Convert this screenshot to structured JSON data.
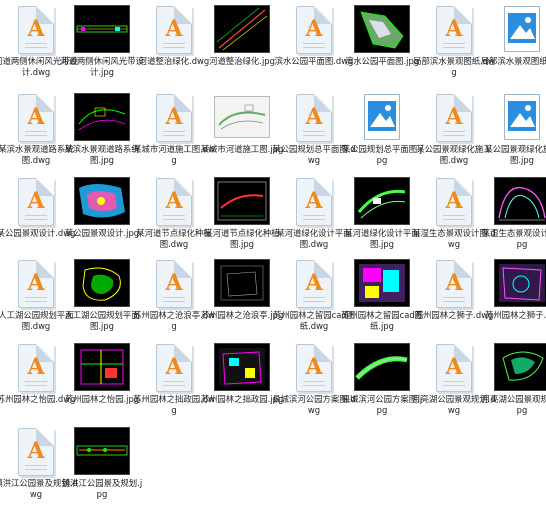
{
  "files": [
    {
      "label": "河道两侧休闲风光带设计.dwg",
      "kind": "dwg"
    },
    {
      "label": "河道两侧休闲风光带设计.jpg",
      "kind": "cad-strip"
    },
    {
      "label": "河道整治绿化.dwg",
      "kind": "dwg"
    },
    {
      "label": "河道整治绿化.jpg",
      "kind": "cad-diag"
    },
    {
      "label": "滨水公园平面图.dwg",
      "kind": "dwg"
    },
    {
      "label": "滨水公园平面图.jpg",
      "kind": "cad-park"
    },
    {
      "label": "局部滨水景观图纸.dwg",
      "kind": "dwg"
    },
    {
      "label": "局部滨水景观图纸.jpg",
      "kind": "image"
    },
    {
      "label": "某滨水景观道路系统图.dwg",
      "kind": "dwg"
    },
    {
      "label": "某滨水景观道路系统图.jpg",
      "kind": "cad-road"
    },
    {
      "label": "某城市河道施工图.dwg",
      "kind": "dwg"
    },
    {
      "label": "某城市河道施工图.jpg",
      "kind": "sketch"
    },
    {
      "label": "某公园规划总平面图.dwg",
      "kind": "dwg"
    },
    {
      "label": "某公园规划总平面图.jpg",
      "kind": "image"
    },
    {
      "label": "某公园景观绿化施工图.dwg",
      "kind": "dwg"
    },
    {
      "label": "某公园景观绿化施工图.jpg",
      "kind": "image"
    },
    {
      "label": "某公园景观设计.dwg",
      "kind": "dwg"
    },
    {
      "label": "某公园景观设计.jpg",
      "kind": "cad-color"
    },
    {
      "label": "某河道节点绿化种植图.dwg",
      "kind": "dwg"
    },
    {
      "label": "某河道节点绿化种植图.jpg",
      "kind": "cad-frame"
    },
    {
      "label": "某河道绿化设计平面图.dwg",
      "kind": "dwg"
    },
    {
      "label": "某河道绿化设计平面图.jpg",
      "kind": "cad-green"
    },
    {
      "label": "某湿生态景观设计图.dwg",
      "kind": "dwg"
    },
    {
      "label": "某湿生态景观设计图.jpg",
      "kind": "cad-curve"
    },
    {
      "label": "人工湖公园规划平面图.dwg",
      "kind": "dwg"
    },
    {
      "label": "人工湖公园规划平面图.jpg",
      "kind": "cad-lake"
    },
    {
      "label": "苏州园林之沧浪亭.dwg",
      "kind": "dwg"
    },
    {
      "label": "苏州园林之沧浪亭.jpg",
      "kind": "cad-dark"
    },
    {
      "label": "苏州园林之留园cad图纸.dwg",
      "kind": "dwg"
    },
    {
      "label": "苏州园林之留园cad图纸.jpg",
      "kind": "cad-purple"
    },
    {
      "label": "苏州园林之狮子.dwg",
      "kind": "dwg"
    },
    {
      "label": "苏州园林之狮子.jpg",
      "kind": "cad-purple2"
    },
    {
      "label": "苏州园林之怡园.dwg",
      "kind": "dwg"
    },
    {
      "label": "苏州园林之怡园.jpg",
      "kind": "cad-multi"
    },
    {
      "label": "苏州园林之拙政园.dwg",
      "kind": "dwg"
    },
    {
      "label": "苏州园林之拙政园.jpg",
      "kind": "cad-multi2"
    },
    {
      "label": "县城滨河公园方案图.dwg",
      "kind": "dwg"
    },
    {
      "label": "县城滨河公园方案图.jpg",
      "kind": "cad-band"
    },
    {
      "label": "月亮湖公园景观规划.dwg",
      "kind": "dwg"
    },
    {
      "label": "月亮湖公园景观规划.jpg",
      "kind": "cad-moon"
    },
    {
      "label": "镇洪江公园景及规划.dwg",
      "kind": "dwg"
    },
    {
      "label": "镇洪江公园景及规划.jpg",
      "kind": "cad-strip2"
    }
  ]
}
